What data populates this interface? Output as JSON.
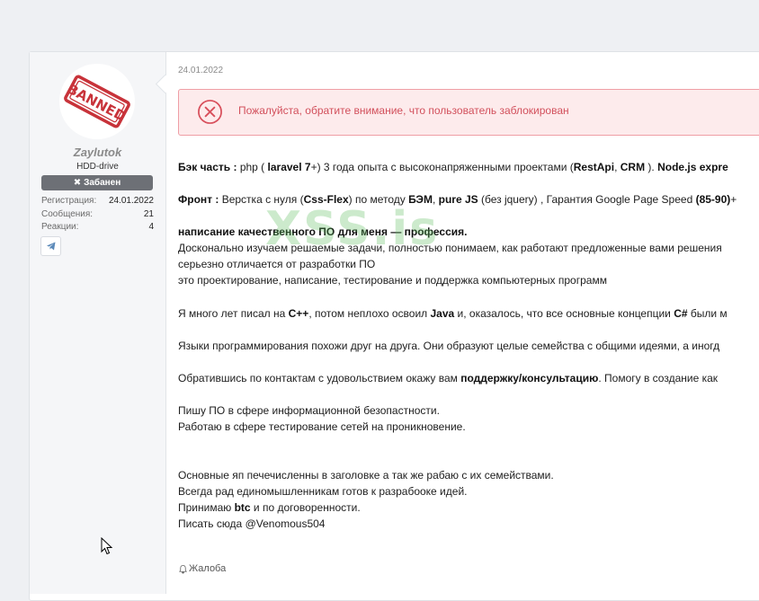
{
  "user": {
    "avatar_stamp_text": "BANNED",
    "name": "Zaylutok",
    "title": "HDD-drive",
    "banned_label": "Забанен",
    "stats": [
      {
        "label": "Регистрация:",
        "value": "24.01.2022"
      },
      {
        "label": "Сообщения:",
        "value": "21"
      },
      {
        "label": "Реакции:",
        "value": "4"
      }
    ]
  },
  "post": {
    "date": "24.01.2022",
    "alert_text": "Пожалуйста, обратите внимание, что пользователь заблокирован",
    "lines": [
      {
        "segments": [
          {
            "t": "Бэк часть : ",
            "b": true
          },
          {
            "t": "php ( "
          },
          {
            "t": "laravel 7",
            "b": true
          },
          {
            "t": "+) 3 года опыта с высоконапряженными проектами ("
          },
          {
            "t": "RestApi",
            "b": true
          },
          {
            "t": ", "
          },
          {
            "t": "CRM",
            "b": true
          },
          {
            "t": " ). "
          },
          {
            "t": "Node.js expre",
            "b": true
          }
        ]
      },
      {
        "segments": [
          {
            "t": "Фронт : ",
            "b": true
          },
          {
            "t": "Верстка с нуля ("
          },
          {
            "t": "Css-Flex",
            "b": true
          },
          {
            "t": ") по методу "
          },
          {
            "t": "БЭМ",
            "b": true
          },
          {
            "t": ", "
          },
          {
            "t": "pure JS",
            "b": true
          },
          {
            "t": " (без jquery) , Гарантия Google Page Speed "
          },
          {
            "t": "(85-90)",
            "b": true
          },
          {
            "t": "+"
          }
        ]
      },
      {
        "segments": [
          {
            "t": "написание качественного ПО для меня — профессия.",
            "b": true
          }
        ]
      },
      {
        "segments": [
          {
            "t": "Досконально изучаем решаемые задачи, полностью понимаем, как работают предложенные вами решения"
          }
        ]
      },
      {
        "segments": [
          {
            "t": "серьезно отличается от разработки ПО"
          }
        ]
      },
      {
        "segments": [
          {
            "t": "это проектирование, написание, тестирование и поддержка компьютерных программ"
          }
        ]
      },
      {
        "segments": [
          {
            "t": "Я много лет писал на "
          },
          {
            "t": "C++",
            "b": true
          },
          {
            "t": ", потом неплохо освоил "
          },
          {
            "t": "Java",
            "b": true
          },
          {
            "t": " и, оказалось, что все основные концепции "
          },
          {
            "t": "C#",
            "b": true
          },
          {
            "t": " были м"
          }
        ]
      },
      {
        "segments": [
          {
            "t": "Языки программирования похожи друг на друга. Они образуют целые семейства с общими идеями, а иногд"
          }
        ]
      },
      {
        "segments": [
          {
            "t": "Обратившись по контактам с удовольствием окажу вам "
          },
          {
            "t": "поддержку/консультацию",
            "b": true
          },
          {
            "t": ". Помогу в создание как"
          }
        ]
      },
      {
        "segments": [
          {
            "t": "Пишу ПО в сфере информационной безопастности."
          }
        ]
      },
      {
        "segments": [
          {
            "t": "Работаю в сфере тестирование сетей на проникновение."
          }
        ]
      },
      {
        "segments": [
          {
            "t": "Основные яп печечисленны в заголовке а так же рабаю с их семействами."
          }
        ]
      },
      {
        "segments": [
          {
            "t": "Всегда рад единомышленникам готов к разрабооке идей."
          }
        ]
      },
      {
        "segments": [
          {
            "t": "Принимаю "
          },
          {
            "t": "btc",
            "b": true
          },
          {
            "t": " и по договоренности."
          }
        ]
      },
      {
        "segments": [
          {
            "t": "Писать сюда @Venomous504"
          }
        ]
      }
    ],
    "watermark": "XSS.is",
    "report_label": "Жалоба"
  },
  "colors": {
    "alert_bg": "#fdebec",
    "alert_border": "#ef9ea5",
    "alert_text": "#d2505c",
    "badge_bg": "#6d7076",
    "watermark": "#5fbe5f"
  },
  "icons": [
    "avatar-banned-stamp",
    "times-icon",
    "telegram-icon",
    "alert-x-circle-icon",
    "bell-icon",
    "mouse-cursor-icon"
  ]
}
